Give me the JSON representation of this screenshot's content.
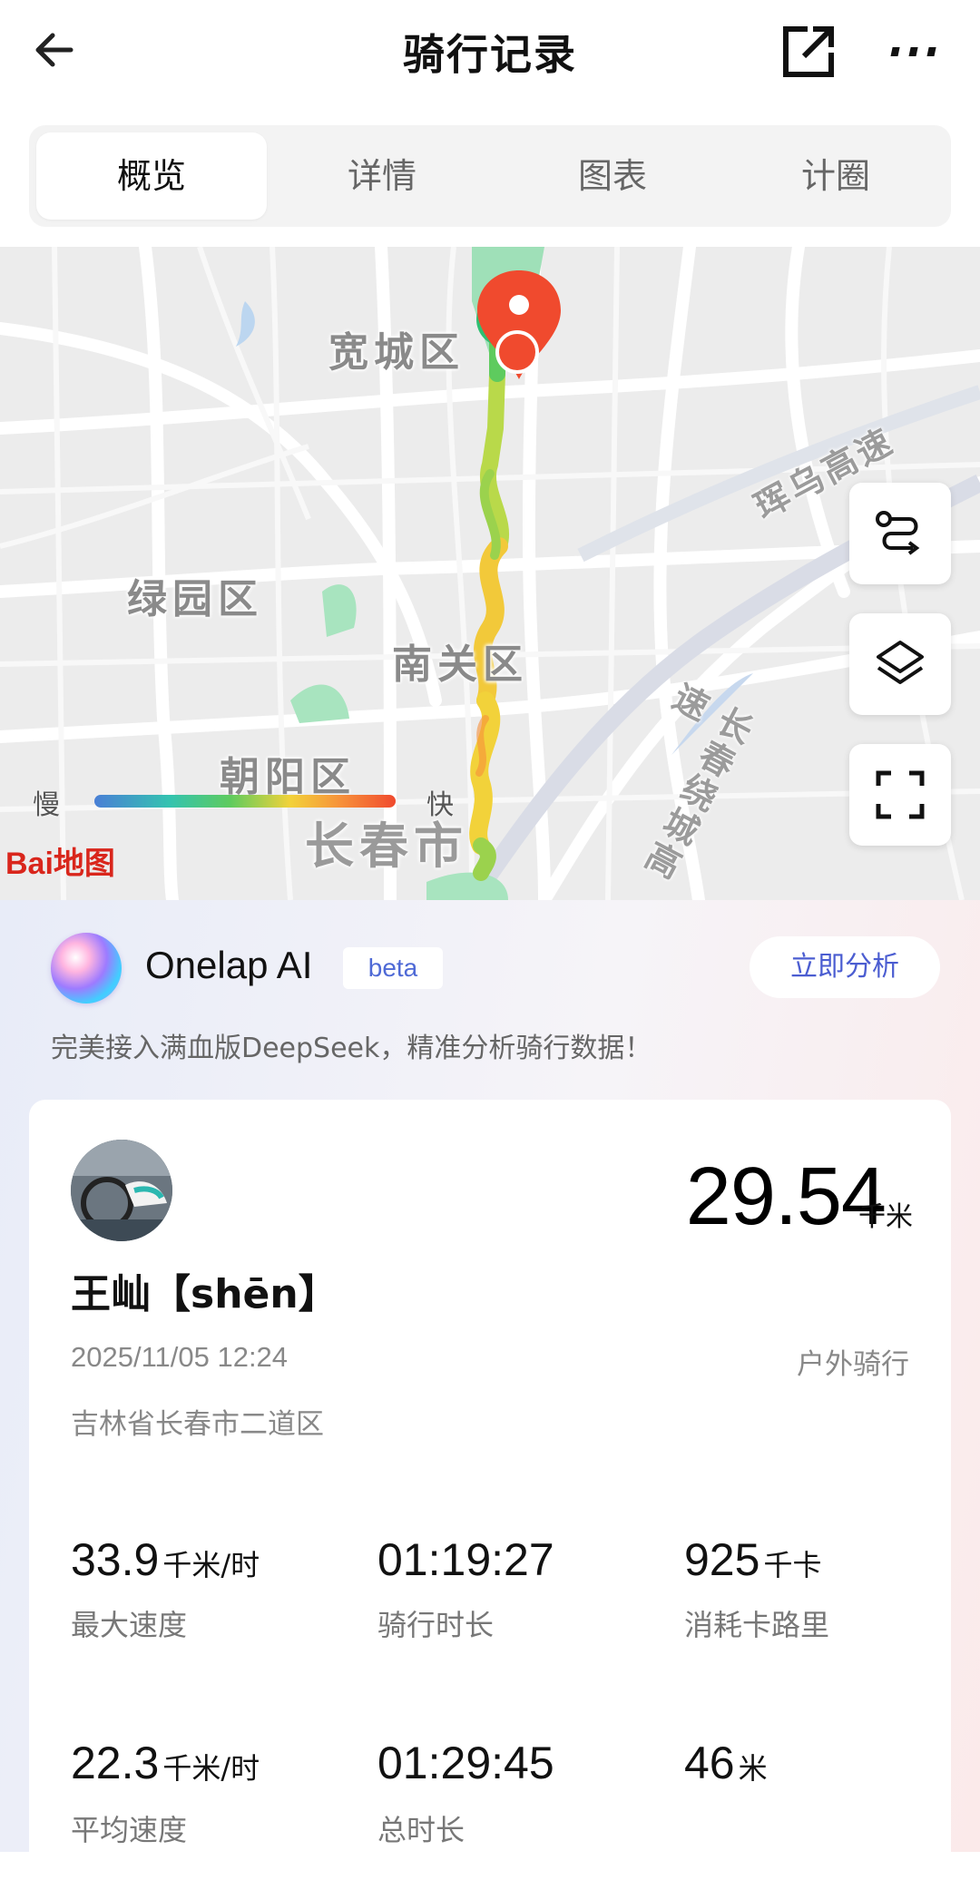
{
  "header": {
    "title": "骑行记录"
  },
  "tabs": [
    {
      "label": "概览",
      "active": true
    },
    {
      "label": "详情",
      "active": false
    },
    {
      "label": "图表",
      "active": false
    },
    {
      "label": "计圈",
      "active": false
    }
  ],
  "map": {
    "districts": [
      "宽城区",
      "绿园区",
      "南关区",
      "朝阳区"
    ],
    "city": "长春市",
    "roads": [
      "珲乌高速",
      "长春绕城高速"
    ],
    "legend": {
      "slow": "慢",
      "fast": "快"
    },
    "logo": "Bai地图",
    "controls": [
      "route-icon",
      "layers-icon",
      "fullscreen-icon"
    ]
  },
  "ai": {
    "title": "Onelap AI",
    "badge": "beta",
    "button": "立即分析",
    "description": "完美接入满血版DeepSeek，精准分析骑行数据！"
  },
  "ride": {
    "distance": "29.54",
    "distance_unit": "千米",
    "user_name": "王屾【shēn】",
    "datetime": "2025/11/05 12:24",
    "type": "户外骑行",
    "location": "吉林省长春市二道区"
  },
  "stats": [
    {
      "value": "33.9",
      "unit": "千米/时",
      "label": "最大速度"
    },
    {
      "value": "01:19:27",
      "unit": "",
      "label": "骑行时长"
    },
    {
      "value": "925",
      "unit": "千卡",
      "label": "消耗卡路里"
    },
    {
      "value": "22.3",
      "unit": "千米/时",
      "label": "平均速度"
    },
    {
      "value": "01:29:45",
      "unit": "",
      "label": "总时长"
    },
    {
      "value": "46",
      "unit": "米",
      "label": ""
    }
  ],
  "colors": {
    "accent": "#f04a2e",
    "ai_button_text": "#4b5dd1",
    "route_start": "#2fbf71"
  }
}
